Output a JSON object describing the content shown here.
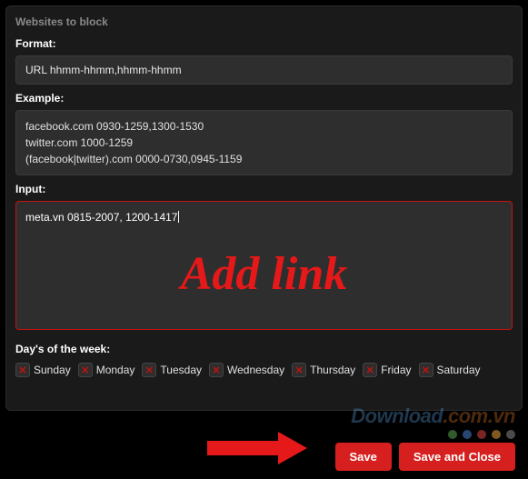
{
  "section": {
    "title": "Websites to block"
  },
  "format": {
    "label": "Format:",
    "value": "URL hhmm-hhmm,hhmm-hhmm"
  },
  "example": {
    "label": "Example:",
    "line1": "facebook.com 0930-1259,1300-1530",
    "line2": "twitter.com 1000-1259",
    "line3": "(facebook|twitter).com 0000-0730,0945-1159"
  },
  "input": {
    "label": "Input:",
    "value": "meta.vn 0815-2007, 1200-1417",
    "annotation": "Add link"
  },
  "days": {
    "label": "Day's of the week:",
    "items": [
      {
        "label": "Sunday",
        "checked": true
      },
      {
        "label": "Monday",
        "checked": true
      },
      {
        "label": "Tuesday",
        "checked": true
      },
      {
        "label": "Wednesday",
        "checked": true
      },
      {
        "label": "Thursday",
        "checked": true
      },
      {
        "label": "Friday",
        "checked": true
      },
      {
        "label": "Saturday",
        "checked": true
      }
    ]
  },
  "buttons": {
    "save": "Save",
    "save_close": "Save and Close"
  },
  "watermark": {
    "main": "Download",
    "suffix": ".com.vn"
  }
}
